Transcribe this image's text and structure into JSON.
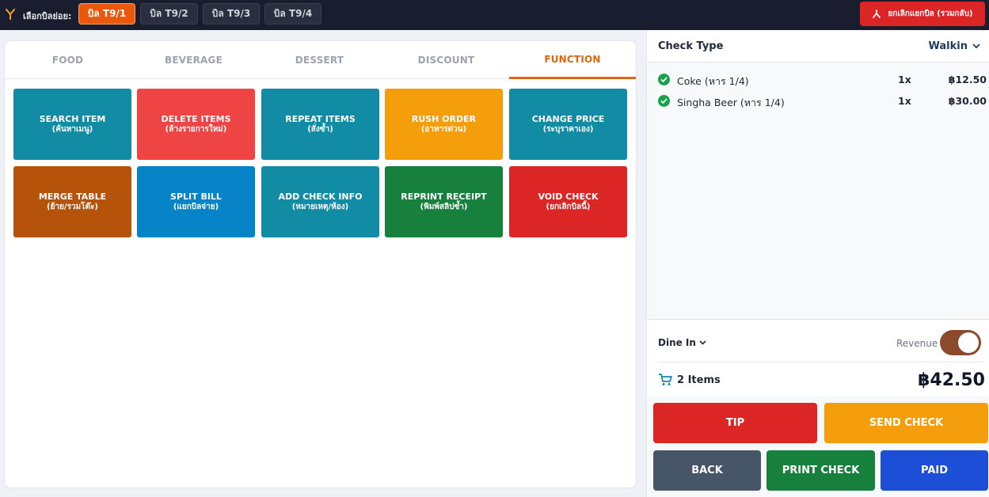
{
  "topbar": {
    "split_label": "เลือกบิลย่อย:",
    "sub_bills": [
      "บิล T9/1",
      "บิล T9/2",
      "บิล T9/3",
      "บิล T9/4"
    ],
    "active_index": 0,
    "cancel_split_label": "ยกเลิกแยกบิล (รวมกลับ)"
  },
  "tabs": [
    "FOOD",
    "BEVERAGE",
    "DESSERT",
    "DISCOUNT",
    "FUNCTION"
  ],
  "active_tab": "FUNCTION",
  "functions": [
    {
      "en": "SEARCH ITEM",
      "th": "(ค้นหาเมนู)",
      "color": "#128ba4"
    },
    {
      "en": "DELETE ITEMS",
      "th": "(ล้างรายการใหม่)",
      "color": "#ef4444"
    },
    {
      "en": "REPEAT ITEMS",
      "th": "(สั่งซ้ำ)",
      "color": "#128ba4"
    },
    {
      "en": "RUSH ORDER",
      "th": "(อาหารด่วน)",
      "color": "#f59e0b"
    },
    {
      "en": "CHANGE PRICE",
      "th": "(ระบุราคาเอง)",
      "color": "#128ba4"
    },
    {
      "en": "MERGE TABLE",
      "th": "(ย้าย/รวมโต๊ะ)",
      "color": "#b45309"
    },
    {
      "en": "SPLIT BILL",
      "th": "(แยกบิลจ่าย)",
      "color": "#0784c7"
    },
    {
      "en": "ADD CHECK INFO",
      "th": "(หมายเหตุ/ห้อง)",
      "color": "#128ba4"
    },
    {
      "en": "REPRINT RECEIPT",
      "th": "(พิมพ์สลิปซ้ำ)",
      "color": "#17803d"
    },
    {
      "en": "VOID CHECK",
      "th": "(ยกเลิกบิลนี้)",
      "color": "#dc2626"
    }
  ],
  "check": {
    "type_label": "Check Type",
    "type_value": "Walkin",
    "items": [
      {
        "name": "Coke (หาร 1/4)",
        "qty": "1x",
        "price": "฿12.50"
      },
      {
        "name": "Singha Beer (หาร 1/4)",
        "qty": "1x",
        "price": "฿30.00"
      }
    ],
    "dine_mode": "Dine In",
    "revenue_label": "Revenue",
    "revenue_on": true,
    "items_count": "2 Items",
    "total": "฿42.50"
  },
  "actions": {
    "tip": "TIP",
    "send_check": "SEND CHECK",
    "back": "BACK",
    "print_check": "PRINT CHECK",
    "paid": "PAID"
  },
  "colors": {
    "accent_orange": "#ea580c",
    "topbar_bg": "#1a1d2e",
    "tip": "#dc2626",
    "send_check": "#f59e0b",
    "back": "#475569",
    "print_check": "#17803d",
    "paid": "#1d4ed8"
  }
}
